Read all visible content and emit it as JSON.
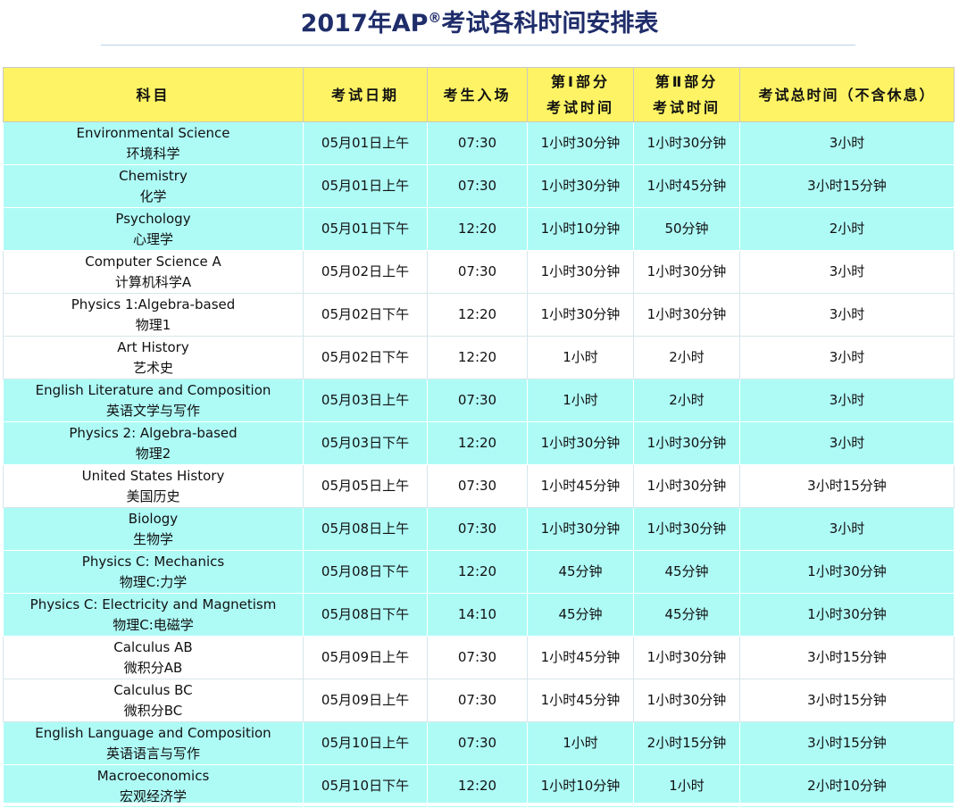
{
  "title": {
    "main_prefix": "2017年AP",
    "reg_mark": "®",
    "main_suffix": "考试各科时间安排表"
  },
  "table": {
    "headers": {
      "subject": "科目",
      "date": "考试日期",
      "entry": "考生入场",
      "part1_line1": "第Ⅰ部分",
      "part1_line2": "考试时间",
      "part2_line1": "第Ⅱ部分",
      "part2_line2": "考试时间",
      "total": "考试总时间（不含休息）"
    },
    "rows": [
      {
        "en": "Environmental Science",
        "cn": "环境科学",
        "date": "05月01日上午",
        "entry": "07:30",
        "part1": "1小时30分钟",
        "part2": "1小时30分钟",
        "total": "3小时",
        "shade": "cyan"
      },
      {
        "en": "Chemistry",
        "cn": "化学",
        "date": "05月01日上午",
        "entry": "07:30",
        "part1": "1小时30分钟",
        "part2": "1小时45分钟",
        "total": "3小时15分钟",
        "shade": "cyan"
      },
      {
        "en": "Psychology",
        "cn": "心理学",
        "date": "05月01日下午",
        "entry": "12:20",
        "part1": "1小时10分钟",
        "part2": "50分钟",
        "total": "2小时",
        "shade": "cyan"
      },
      {
        "en": "Computer Science A",
        "cn": "计算机科学A",
        "date": "05月02日上午",
        "entry": "07:30",
        "part1": "1小时30分钟",
        "part2": "1小时30分钟",
        "total": "3小时",
        "shade": "white"
      },
      {
        "en": "Physics 1:Algebra-based",
        "cn": "物理1",
        "date": "05月02日下午",
        "entry": "12:20",
        "part1": "1小时30分钟",
        "part2": "1小时30分钟",
        "total": "3小时",
        "shade": "white"
      },
      {
        "en": "Art History",
        "cn": "艺术史",
        "date": "05月02日下午",
        "entry": "12:20",
        "part1": "1小时",
        "part2": "2小时",
        "total": "3小时",
        "shade": "white"
      },
      {
        "en": "English Literature and Composition",
        "cn": "英语文学与写作",
        "date": "05月03日上午",
        "entry": "07:30",
        "part1": "1小时",
        "part2": "2小时",
        "total": "3小时",
        "shade": "cyan"
      },
      {
        "en": "Physics 2: Algebra-based",
        "cn": "物理2",
        "date": "05月03日下午",
        "entry": "12:20",
        "part1": "1小时30分钟",
        "part2": "1小时30分钟",
        "total": "3小时",
        "shade": "cyan"
      },
      {
        "en": "United States History",
        "cn": "美国历史",
        "date": "05月05日上午",
        "entry": "07:30",
        "part1": "1小时45分钟",
        "part2": "1小时30分钟",
        "total": "3小时15分钟",
        "shade": "white"
      },
      {
        "en": "Biology",
        "cn": "生物学",
        "date": "05月08日上午",
        "entry": "07:30",
        "part1": "1小时30分钟",
        "part2": "1小时30分钟",
        "total": "3小时",
        "shade": "cyan"
      },
      {
        "en": "Physics C: Mechanics",
        "cn": "物理C:力学",
        "date": "05月08日下午",
        "entry": "12:20",
        "part1": "45分钟",
        "part2": "45分钟",
        "total": "1小时30分钟",
        "shade": "cyan"
      },
      {
        "en": "Physics C: Electricity and Magnetism",
        "cn": "物理C:电磁学",
        "date": "05月08日下午",
        "entry": "14:10",
        "part1": "45分钟",
        "part2": "45分钟",
        "total": "1小时30分钟",
        "shade": "cyan"
      },
      {
        "en": "Calculus AB",
        "cn": "微积分AB",
        "date": "05月09日上午",
        "entry": "07:30",
        "part1": "1小时45分钟",
        "part2": "1小时30分钟",
        "total": "3小时15分钟",
        "shade": "white"
      },
      {
        "en": "Calculus BC",
        "cn": "微积分BC",
        "date": "05月09日上午",
        "entry": "07:30",
        "part1": "1小时45分钟",
        "part2": "1小时30分钟",
        "total": "3小时15分钟",
        "shade": "white"
      },
      {
        "en": "English Language and Composition",
        "cn": "英语语言与写作",
        "date": "05月10日上午",
        "entry": "07:30",
        "part1": "1小时",
        "part2": "2小时15分钟",
        "total": "3小时15分钟",
        "shade": "cyan"
      },
      {
        "en": "Macroeconomics",
        "cn": "宏观经济学",
        "date": "05月10日下午",
        "entry": "12:20",
        "part1": "1小时10分钟",
        "part2": "1小时",
        "total": "2小时10分钟",
        "shade": "cyan"
      }
    ]
  },
  "colors": {
    "title": "#1f2d6a",
    "header_bg": "#fdf364",
    "cyan_row": "#aefbf6",
    "white_row": "#ffffff",
    "rule": "#b6d2ea"
  }
}
